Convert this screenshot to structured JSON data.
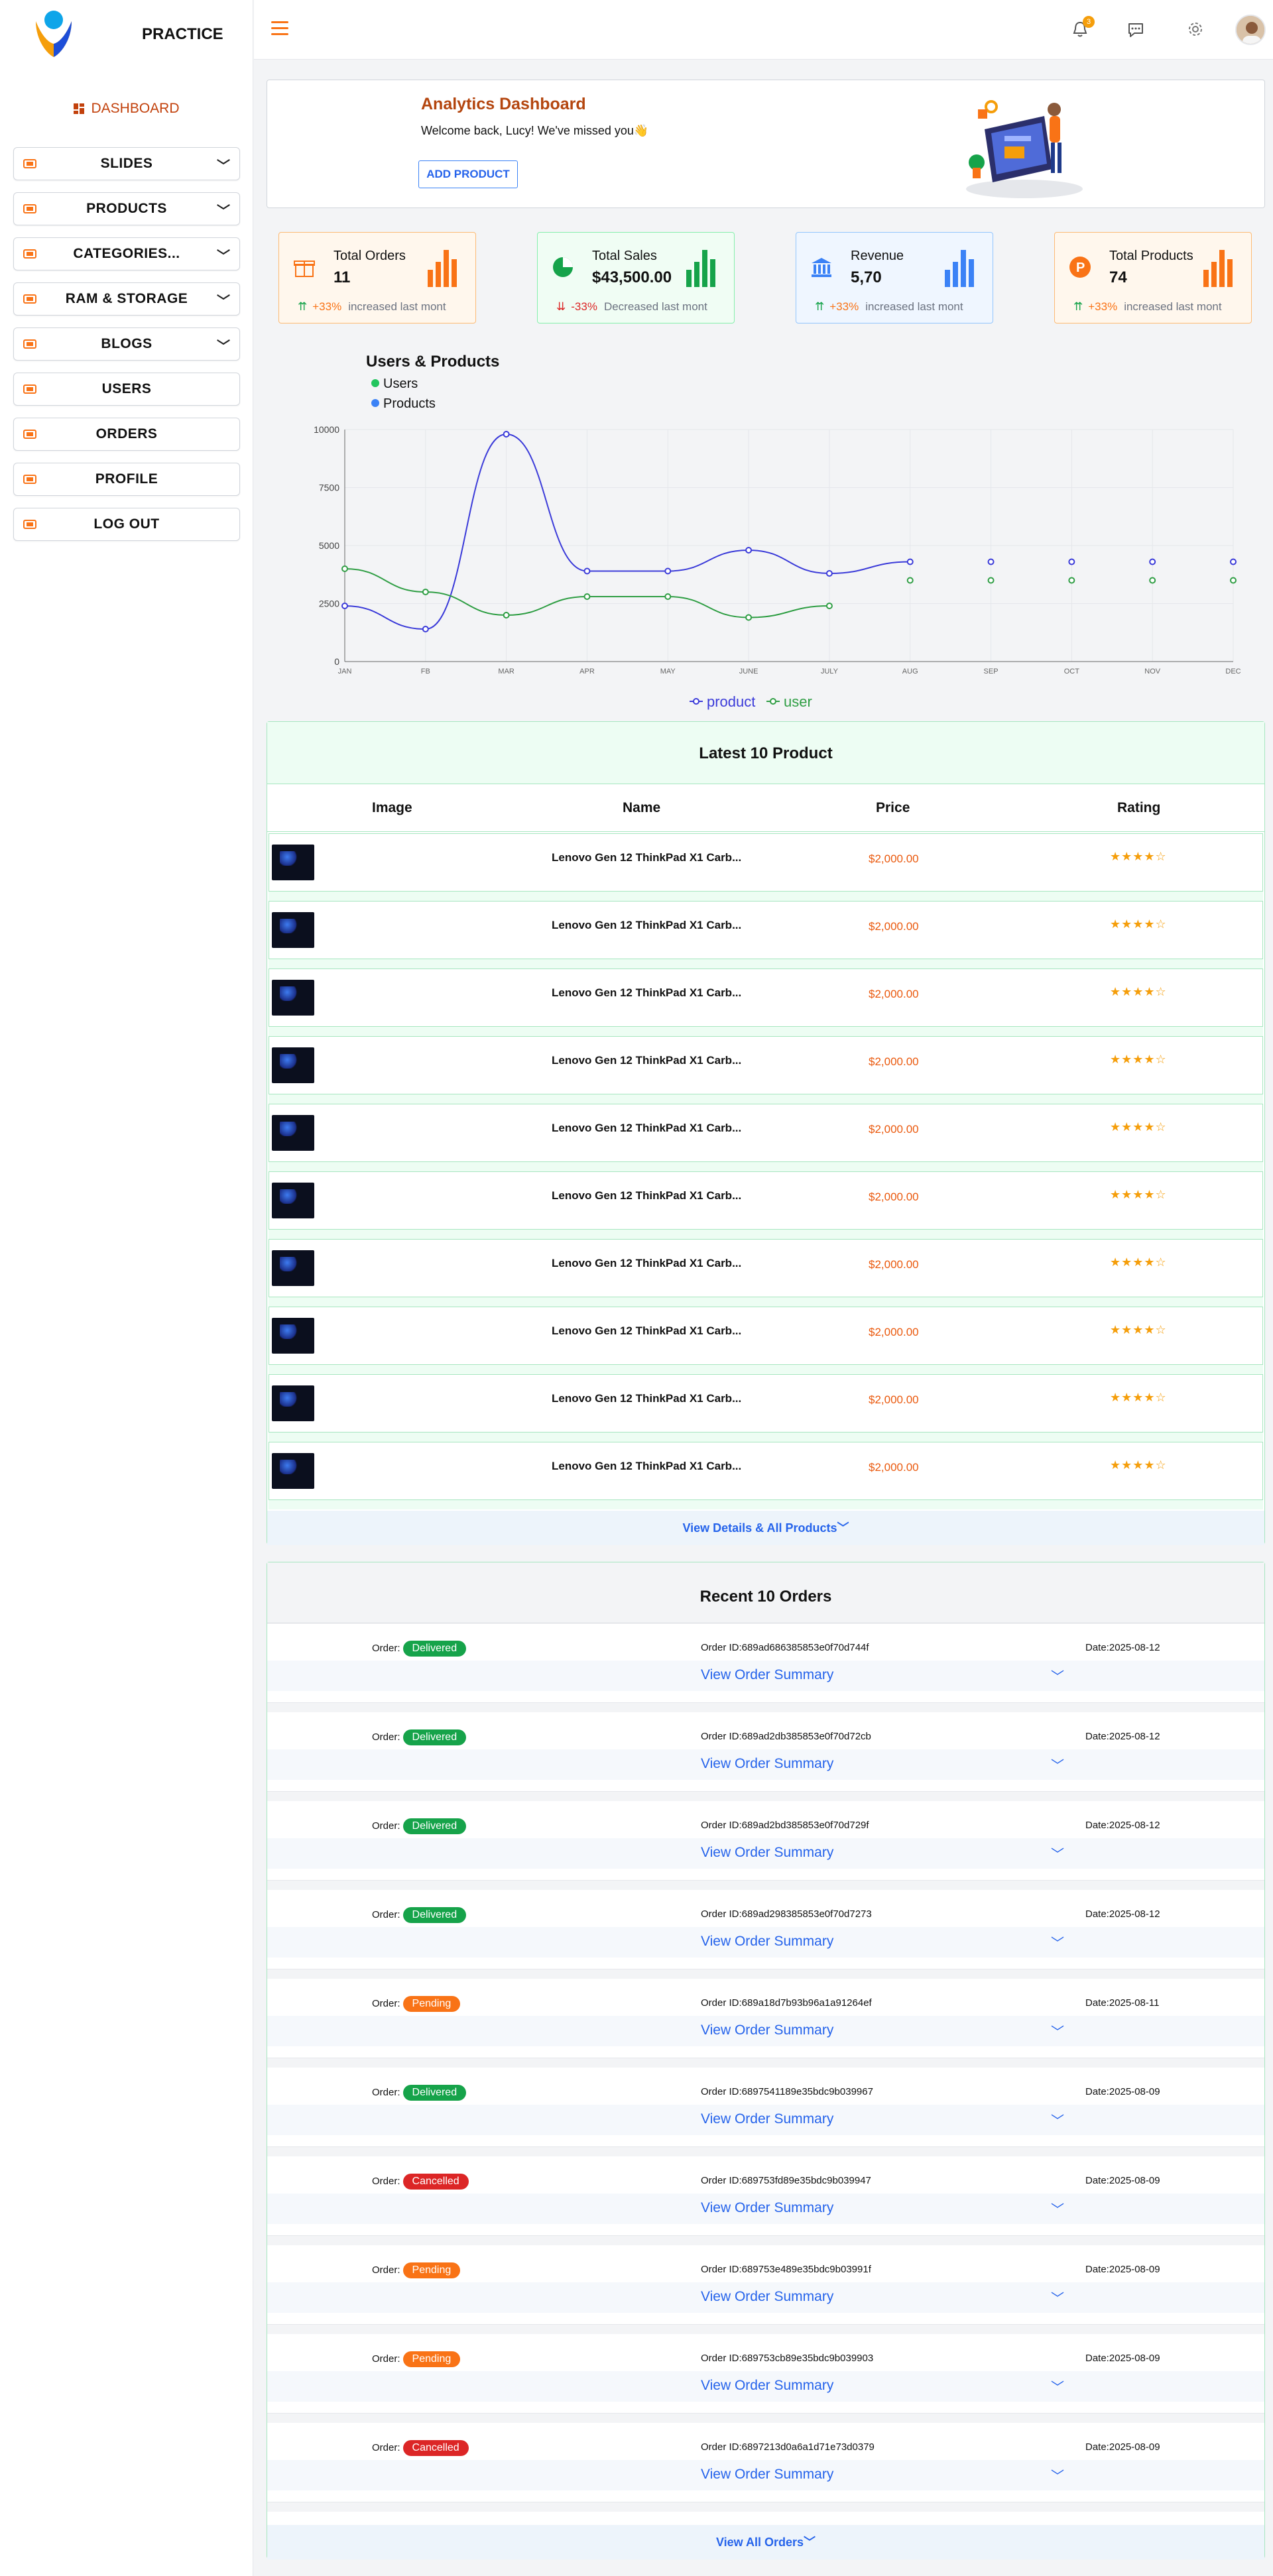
{
  "brand": "PRACTICE",
  "sidebar": {
    "dashboard": "DASHBOARD",
    "items": [
      {
        "label": "SLIDES",
        "chev": "﹀"
      },
      {
        "label": "PRODUCTS",
        "chev": "﹀"
      },
      {
        "label": "CATEGORIES...",
        "chev": "﹀"
      },
      {
        "label": "RAM & STORAGE",
        "chev": "﹀"
      },
      {
        "label": "BLOGS",
        "chev": "﹀"
      },
      {
        "label": "USERS",
        "chev": ""
      },
      {
        "label": "ORDERS",
        "chev": ""
      },
      {
        "label": "PROFILE",
        "chev": ""
      },
      {
        "label": "LOG OUT",
        "chev": ""
      }
    ]
  },
  "header": {
    "notif_count": "3"
  },
  "hero": {
    "title": "Analytics Dashboard",
    "welcome": "Welcome back, Lucy! We've missed you👋",
    "button": "ADD PRODUCT"
  },
  "stats": [
    {
      "title": "Total Orders",
      "value": "11",
      "pct": "+33%",
      "note": "increased last mont",
      "dir": "up",
      "accent": "#f97316",
      "bg": "#fff7ed",
      "border": "#fdba74"
    },
    {
      "title": "Total Sales",
      "value": "$43,500.00",
      "pct": "-33%",
      "note": "Decreased last mont",
      "dir": "down",
      "accent": "#16a34a",
      "bg": "#f0fdf4",
      "border": "#86efac"
    },
    {
      "title": "Revenue",
      "value": "5,70",
      "pct": "+33%",
      "note": "increased last mont",
      "dir": "up",
      "accent": "#3b82f6",
      "bg": "#eff6ff",
      "border": "#93c5fd"
    },
    {
      "title": "Total Products",
      "value": "74",
      "pct": "+33%",
      "note": "increased last mont",
      "dir": "up",
      "accent": "#f97316",
      "bg": "#fff7ed",
      "border": "#fdba74"
    }
  ],
  "chart_data": {
    "type": "line",
    "title": "Users & Products",
    "categories": [
      "JAN",
      "FB",
      "MAR",
      "APR",
      "MAY",
      "JUNE",
      "JULY",
      "AUG",
      "SEP",
      "OCT",
      "NOV",
      "DEC"
    ],
    "ylim": [
      0,
      10000
    ],
    "yticks": [
      0,
      2500,
      5000,
      7500,
      10000
    ],
    "series": [
      {
        "name": "product",
        "color": "#3b3bd9",
        "values": [
          2400,
          1400,
          9800,
          3900,
          3900,
          4800,
          3800,
          4300,
          4300,
          4300,
          4300,
          4300
        ]
      },
      {
        "name": "user",
        "color": "#2f9e44",
        "values": [
          4000,
          3000,
          2000,
          2800,
          2800,
          1900,
          2400,
          3500,
          3500,
          3500,
          3500,
          3500
        ]
      }
    ],
    "legend_top": [
      "Users",
      "Products"
    ],
    "legend_top_colors": [
      "#22c55e",
      "#3b82f6"
    ],
    "grid": true
  },
  "products": {
    "title": "Latest 10 Product",
    "columns": [
      "Image",
      "Name",
      "Price",
      "Rating"
    ],
    "rows": [
      {
        "name": "Lenovo Gen 12 ThinkPad X1 Carb...",
        "price": "$2,000.00",
        "rating": "★★★★☆"
      },
      {
        "name": "Lenovo Gen 12 ThinkPad X1 Carb...",
        "price": "$2,000.00",
        "rating": "★★★★☆"
      },
      {
        "name": "Lenovo Gen 12 ThinkPad X1 Carb...",
        "price": "$2,000.00",
        "rating": "★★★★☆"
      },
      {
        "name": "Lenovo Gen 12 ThinkPad X1 Carb...",
        "price": "$2,000.00",
        "rating": "★★★★☆"
      },
      {
        "name": "Lenovo Gen 12 ThinkPad X1 Carb...",
        "price": "$2,000.00",
        "rating": "★★★★☆"
      },
      {
        "name": "Lenovo Gen 12 ThinkPad X1 Carb...",
        "price": "$2,000.00",
        "rating": "★★★★☆"
      },
      {
        "name": "Lenovo Gen 12 ThinkPad X1 Carb...",
        "price": "$2,000.00",
        "rating": "★★★★☆"
      },
      {
        "name": "Lenovo Gen 12 ThinkPad X1 Carb...",
        "price": "$2,000.00",
        "rating": "★★★★☆"
      },
      {
        "name": "Lenovo Gen 12 ThinkPad X1 Carb...",
        "price": "$2,000.00",
        "rating": "★★★★☆"
      },
      {
        "name": "Lenovo Gen 12 ThinkPad X1 Carb...",
        "price": "$2,000.00",
        "rating": "★★★★☆"
      }
    ],
    "more": "View Details & All Products﹀"
  },
  "orders": {
    "title": "Recent 10 Orders",
    "order_label": "Order:",
    "summary_label": "View Order Summary",
    "chev": "﹀",
    "status_colors": {
      "Delivered": "#16a34a",
      "Pending": "#f97316",
      "Cancelled": "#dc2626"
    },
    "rows": [
      {
        "status": "Delivered",
        "id": "Order ID:689ad686385853e0f70d744f",
        "date": "Date:2025-08-12"
      },
      {
        "status": "Delivered",
        "id": "Order ID:689ad2db385853e0f70d72cb",
        "date": "Date:2025-08-12"
      },
      {
        "status": "Delivered",
        "id": "Order ID:689ad2bd385853e0f70d729f",
        "date": "Date:2025-08-12"
      },
      {
        "status": "Delivered",
        "id": "Order ID:689ad298385853e0f70d7273",
        "date": "Date:2025-08-12"
      },
      {
        "status": "Pending",
        "id": "Order ID:689a18d7b93b96a1a91264ef",
        "date": "Date:2025-08-11"
      },
      {
        "status": "Delivered",
        "id": "Order ID:6897541189e35bdc9b039967",
        "date": "Date:2025-08-09"
      },
      {
        "status": "Cancelled",
        "id": "Order ID:689753fd89e35bdc9b039947",
        "date": "Date:2025-08-09"
      },
      {
        "status": "Pending",
        "id": "Order ID:689753e489e35bdc9b03991f",
        "date": "Date:2025-08-09"
      },
      {
        "status": "Pending",
        "id": "Order ID:689753cb89e35bdc9b039903",
        "date": "Date:2025-08-09"
      },
      {
        "status": "Cancelled",
        "id": "Order ID:6897213d0a6a1d71e73d0379",
        "date": "Date:2025-08-09"
      }
    ],
    "more": "View All Orders﹀"
  }
}
